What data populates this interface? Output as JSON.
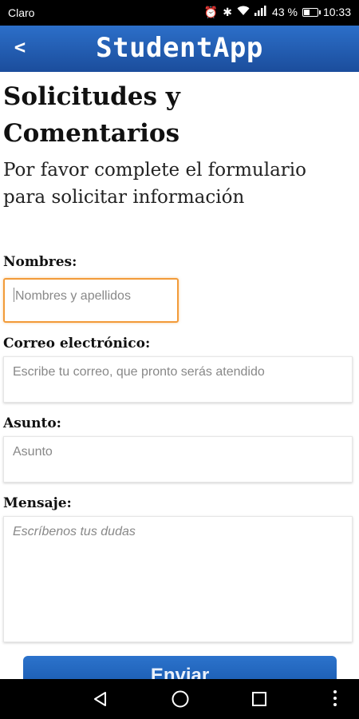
{
  "status_bar": {
    "carrier": "Claro",
    "battery": "43 %",
    "battery_level": 0.43,
    "time": "10:33",
    "icons": [
      "alarm-icon",
      "bluetooth-icon",
      "wifi-icon",
      "signal-icon",
      "battery-icon"
    ]
  },
  "app_bar": {
    "back_label": "<",
    "title": "StudentApp",
    "color": "#1f57a8"
  },
  "page": {
    "title": "Solicitudes y Comentarios",
    "subtitle": "Por favor complete el formulario para solicitar información"
  },
  "form": {
    "names_label": "Nombres:",
    "names_placeholder": "Nombres y apellidos",
    "email_label": "Correo electrónico:",
    "email_placeholder": "Escribe tu correo, que pronto serás atendido",
    "subject_label": "Asunto:",
    "subject_placeholder": "Asunto",
    "message_label": "Mensaje:",
    "message_placeholder": "Escríbenos tus dudas",
    "submit_label": "Enviar",
    "focus_color": "#f29b39"
  },
  "nav_bar": {
    "icons": [
      "back-triangle-icon",
      "home-circle-icon",
      "recents-square-icon",
      "more-vertical-icon"
    ]
  }
}
